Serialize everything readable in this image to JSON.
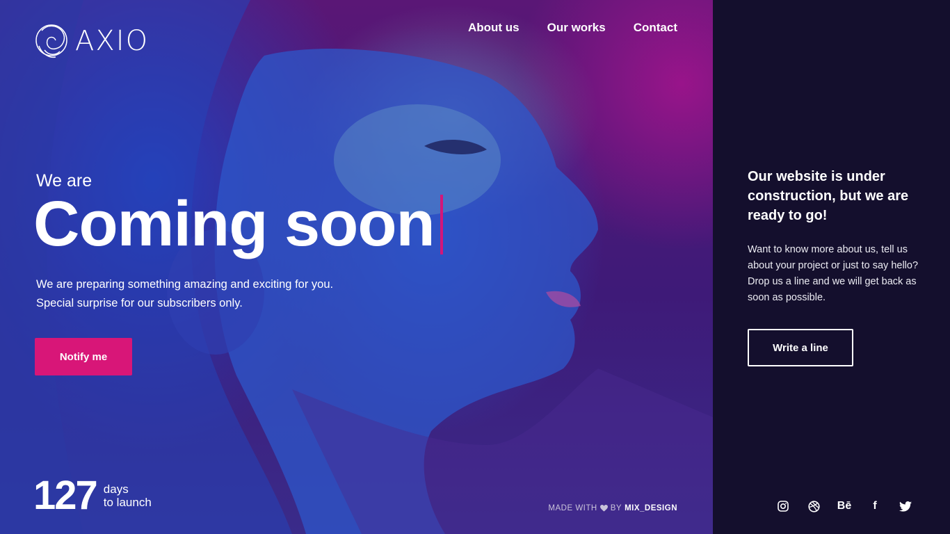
{
  "brand": {
    "name": "AXIO"
  },
  "nav": {
    "items": [
      {
        "label": "About us"
      },
      {
        "label": "Our works"
      },
      {
        "label": "Contact"
      }
    ]
  },
  "hero": {
    "kicker": "We are",
    "title": "Coming soon",
    "lead_line1": "We are preparing something amazing and exciting for you.",
    "lead_line2": "Special surprise for our subscribers only.",
    "notify_label": "Notify me"
  },
  "countdown": {
    "number": "127",
    "unit": "days",
    "caption": "to launch"
  },
  "footer": {
    "made_with": "MADE WITH",
    "by": "BY",
    "author": "MIX_DESIGN"
  },
  "panel": {
    "title": "Our website is under construction, but we are ready to go!",
    "body": "Want to know more about us, tell us about your project or just to say hello? Drop us a line and we will get back as soon as possible.",
    "button_label": "Write a line"
  },
  "social": {
    "icons": [
      "instagram-icon",
      "dribbble-icon",
      "behance-icon",
      "facebook-icon",
      "twitter-icon"
    ],
    "behance_text": "Bē",
    "facebook_text": "f"
  },
  "colors": {
    "accent": "#d81678",
    "panel_bg": "#140f2d",
    "text": "#ffffff"
  }
}
